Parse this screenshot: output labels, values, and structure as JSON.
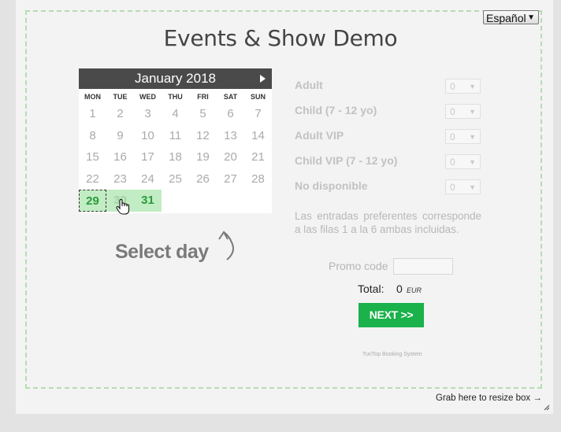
{
  "page": {
    "title": "Events & Show Demo",
    "language": "Español"
  },
  "calendar": {
    "month_label": "January 2018",
    "weekdays": [
      "MON",
      "TUE",
      "WED",
      "THU",
      "FRI",
      "SAT",
      "SUN"
    ],
    "weeks": [
      [
        "1",
        "2",
        "3",
        "4",
        "5",
        "6",
        "7"
      ],
      [
        "8",
        "9",
        "10",
        "11",
        "12",
        "13",
        "14"
      ],
      [
        "15",
        "16",
        "17",
        "18",
        "19",
        "20",
        "21"
      ],
      [
        "22",
        "23",
        "24",
        "25",
        "26",
        "27",
        "28"
      ],
      [
        "29",
        "30",
        "31",
        "",
        "",
        "",
        ""
      ]
    ],
    "available_days": [
      "29",
      "30",
      "31"
    ],
    "selected_day": "29",
    "prompt": "Select day"
  },
  "tickets": [
    {
      "label": "Adult",
      "value": "0"
    },
    {
      "label": "Child (7 - 12 yo)",
      "value": "0"
    },
    {
      "label": "Adult VIP",
      "value": "0"
    },
    {
      "label": "Child VIP (7 - 12 yo)",
      "value": "0"
    },
    {
      "label": "No disponible",
      "value": "0"
    }
  ],
  "note": "Las entradas preferentes corresponde a las filas 1 a la 6 ambas incluidas.",
  "promo": {
    "label": "Promo code",
    "value": ""
  },
  "total": {
    "label": "Total:",
    "value": "0",
    "currency": "EUR"
  },
  "next_label": "NEXT >>",
  "footer": "TuriTop Booking System",
  "resize_hint": "Grab here to resize box →",
  "colors": {
    "accent": "#1bb14b",
    "available_day_bg": "#c2ecc4",
    "header_bg": "#4a4a4a"
  }
}
